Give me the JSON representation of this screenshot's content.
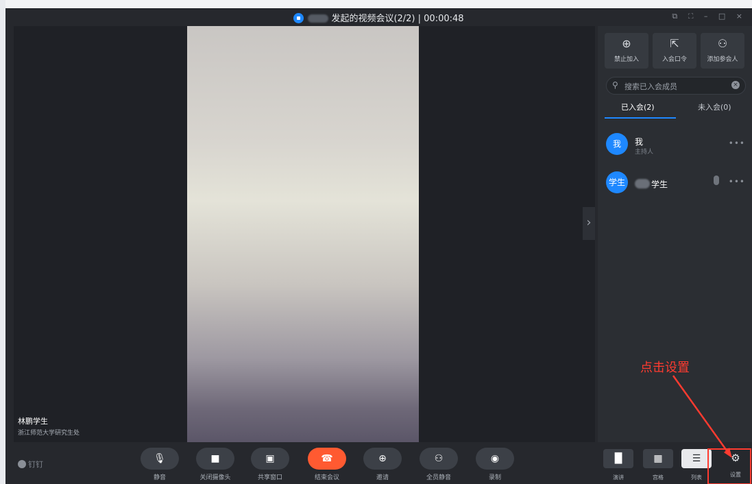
{
  "window": {
    "title_suffix": "发起的视频会议(2/2) | 00:00:48",
    "controls": "⧉ ⛶ – □ ×"
  },
  "stage": {
    "speaker_name": "林鹏学生",
    "speaker_org": "浙江师范大学研究生处"
  },
  "panel": {
    "top_buttons": [
      {
        "icon": "lock-open-icon",
        "glyph": "⊕",
        "label": "禁止加入"
      },
      {
        "icon": "share-link-icon",
        "glyph": "⇱",
        "label": "入会口令"
      },
      {
        "icon": "add-person-icon",
        "glyph": "⚇",
        "label": "添加参会人"
      }
    ],
    "search_placeholder": "搜索已入会成员",
    "tabs": [
      {
        "label": "已入会(2)",
        "active": true
      },
      {
        "label": "未入会(0)",
        "active": false
      }
    ],
    "members": [
      {
        "avatar": "我",
        "name": "我",
        "role": "主持人"
      },
      {
        "avatar": "学生",
        "name": "学生",
        "role": ""
      }
    ]
  },
  "bottombar": {
    "brand": "钉钉",
    "controls": [
      {
        "label": "静音",
        "glyph": "🎙"
      },
      {
        "label": "关闭摄像头",
        "glyph": "■"
      },
      {
        "label": "共享窗口",
        "glyph": "▣"
      },
      {
        "label": "结束会议",
        "glyph": "☎"
      },
      {
        "label": "邀请",
        "glyph": "⊕"
      },
      {
        "label": "全员静音",
        "glyph": "⚇"
      },
      {
        "label": "录制",
        "glyph": "◉"
      }
    ],
    "views": [
      {
        "label": "演讲",
        "glyph": "▐▌",
        "active": false
      },
      {
        "label": "宫格",
        "glyph": "▦",
        "active": false
      },
      {
        "label": "列表",
        "glyph": "☰",
        "active": true
      }
    ],
    "settings_label": "设置"
  },
  "annotation": {
    "text": "点击设置",
    "color": "#ff3b30"
  },
  "colors": {
    "accent": "#1e88ff",
    "end_call": "#ff5a31",
    "background": "#26282d"
  }
}
